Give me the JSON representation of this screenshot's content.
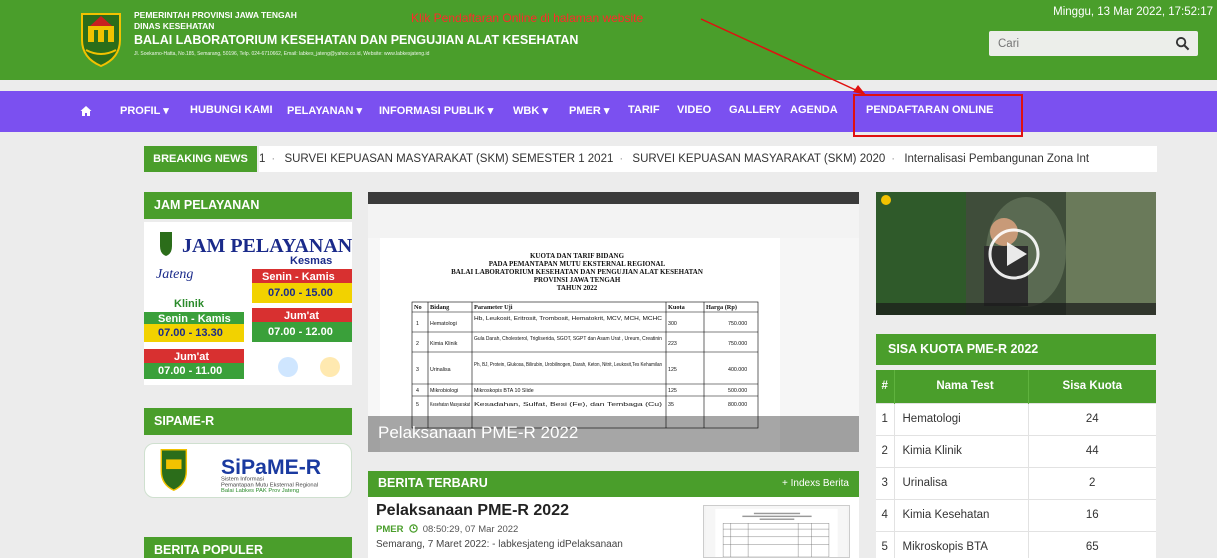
{
  "header": {
    "org_line1": "PEMERINTAH PROVINSI JAWA TENGAH",
    "org_line2": "DINAS KESEHATAN",
    "org_line3": "BALAI LABORATORIUM KESEHATAN DAN PENGUJIAN ALAT KESEHATAN",
    "address": "Jl. Soekarno-Hatta, No.185, Semarang, 50196, Telp. 024-6710662, Email: labkes_jateng@yahoo.co.id, Website: www.labkesjateng.id",
    "annotation": "Klik Pendaftaran Online di halaman website",
    "datetime": "Minggu, 13 Mar 2022, 17:52:17",
    "search_placeholder": "Cari"
  },
  "nav": {
    "items": [
      "PROFIL ▾",
      "HUBUNGI KAMI",
      "PELAYANAN ▾",
      "INFORMASI PUBLIK ▾",
      "WBK ▾",
      "PMER ▾",
      "TARIF",
      "VIDEO",
      "GALLERY",
      "AGENDA",
      "PENDAFTARAN ONLINE"
    ]
  },
  "breaking": {
    "label": "BREAKING NEWS",
    "items": [
      "SURVEI KEPUASAN MASYARAKAT (SKM) SEMESTER 1 2021",
      "SURVEI KEPUASAN MASYARAKAT (SKM) 2020",
      "Internalisasi Pembangunan Zona Int"
    ]
  },
  "left": {
    "jam_title": "JAM PELAYANAN",
    "sipame_title": "SIPAME-R",
    "populer_title": "BERITA POPULER",
    "jam_img": {
      "heading": "JAM PELAYANAN",
      "jateng": "Jateng",
      "klinik": "Klinik",
      "kesmas": "Kesmas",
      "senin_kamis": "Senin - Kamis",
      "k_time1": "07.00 - 13.30",
      "k_time2": "07.00 - 15.00",
      "jumat": "Jum'at",
      "k_time3": "07.00 - 12.00",
      "k_time4": "07.00 - 11.00"
    },
    "sipame_img": {
      "brand": "SiPaME-R",
      "l1": "Sistem Informasi",
      "l2": "Pemantapan Mutu Eksternal Regional",
      "l3": "Balai Labkes PAK Prov Jateng"
    }
  },
  "center": {
    "slide_caption": "Pelaksanaan PME-R 2022",
    "doc_title1": "KUOTA DAN TARIF BIDANG",
    "doc_title2": "PADA PEMANTAPAN MUTU EKSTERNAL REGIONAL",
    "doc_title3": "BALAI LABORATORIUM KESEHATAN DAN PENGUJIAN ALAT KESEHATAN",
    "doc_title4": "PROVINSI JAWA TENGAH",
    "doc_title5": "TAHUN 2022",
    "doc_headers": [
      "No",
      "Bidang",
      "Parameter Uji",
      "Kuota",
      "Harga (Rp)"
    ],
    "doc_rows": [
      [
        "1",
        "Hematologi",
        "Hb, Leukosit, Eritrosit, Trombosit, Hematokrit, MCV, MCH, MCHC",
        "300",
        "750.000"
      ],
      [
        "2",
        "Kimia Klinik",
        "Gula Darah, Cholesterol, Trigliserida, SGOT, SGPT dan Asam Urat , Ureum, Creatinin",
        "223",
        "750.000"
      ],
      [
        "3",
        "Urinalisa",
        "Ph, BJ, Protein, Glukosa, Bilirubin, Urobilinogen, Darah, Keton, Nitrit, Leukosit,Tes Kehamilan",
        "125",
        "400.000"
      ],
      [
        "4",
        "Mikrobiologi",
        "Mikroskopis BTA 10 Slide",
        "125",
        "500.000"
      ],
      [
        "5",
        "Kesehatan Masyarakat",
        "Kesadahan, Sulfat, Besi (Fe), dan Tembaga (Cu)",
        "35",
        "800.000"
      ]
    ],
    "berita_title": "BERITA TERBARU",
    "berita_link": "+ Indexs Berita",
    "news_title": "Pelaksanaan PME-R 2022",
    "news_category": "PMER",
    "news_time": "08:50:29, 07 Mar 2022",
    "news_excerpt": "Semarang, 7 Maret 2022: - labkesjateng idPelaksanaan"
  },
  "right": {
    "kuota_title": "SISA KUOTA PME-R 2022",
    "table_headers": [
      "#",
      "Nama Test",
      "Sisa Kuota"
    ],
    "table_rows": [
      {
        "no": "1",
        "name": "Hematologi",
        "quota": "24"
      },
      {
        "no": "2",
        "name": "Kimia Klinik",
        "quota": "44"
      },
      {
        "no": "3",
        "name": "Urinalisa",
        "quota": "2"
      },
      {
        "no": "4",
        "name": "Kimia Kesehatan",
        "quota": "16"
      },
      {
        "no": "5",
        "name": "Mikroskopis BTA",
        "quota": "65"
      }
    ]
  },
  "colors": {
    "header_green": "#4a9e2b",
    "nav_purple": "#7b50f0",
    "highlight_red": "#e01010"
  },
  "icons": {
    "home": "home-icon",
    "search": "search-icon",
    "play": "play-icon",
    "clock": "clock-icon"
  }
}
